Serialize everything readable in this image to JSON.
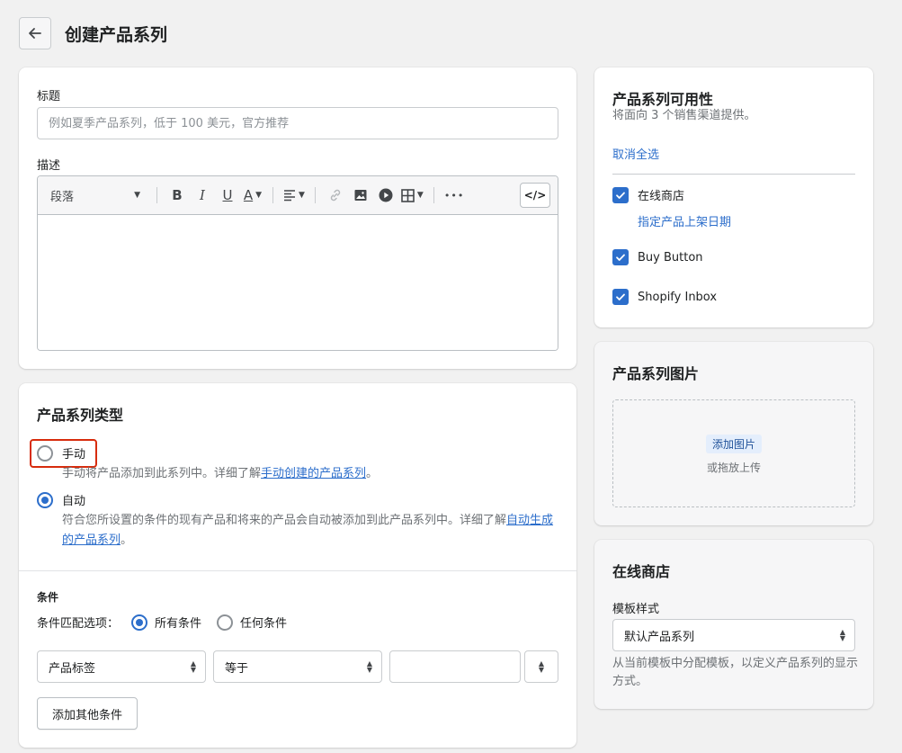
{
  "page": {
    "title": "创建产品系列"
  },
  "details": {
    "title_label": "标题",
    "title_placeholder": "例如夏季产品系列，低于 100 美元，官方推荐",
    "desc_label": "描述",
    "editor": {
      "format_select": "段落",
      "bold": "B",
      "italic": "I",
      "underline": "U",
      "text_color": "A",
      "more": "•••",
      "code": "</>"
    }
  },
  "collection_type": {
    "title": "产品系列类型",
    "manual": {
      "label": "手动",
      "help_prefix": "手动将产品添加到此系列中。详细了解",
      "help_link": "手动创建的产品系列",
      "help_suffix": "。"
    },
    "automatic": {
      "label": "自动",
      "help_prefix": "符合您所设置的条件的现有产品和将来的产品会自动被添加到此产品系列中。详细了解",
      "help_link": "自动生成的产品系列",
      "help_suffix": "。"
    },
    "selected": "automatic",
    "conditions": {
      "title": "条件",
      "match_label": "条件匹配选项：",
      "all_label": "所有条件",
      "any_label": "任何条件",
      "field": "产品标签",
      "operator": "等于",
      "value": "",
      "add_button": "添加其他条件"
    }
  },
  "availability": {
    "title": "产品系列可用性",
    "subtitle": "将面向 3 个销售渠道提供。",
    "deselect_all": "取消全选",
    "channels": [
      {
        "label": "在线商店",
        "checked": true,
        "sub_link": "指定产品上架日期"
      },
      {
        "label": "Buy Button",
        "checked": true
      },
      {
        "label": "Shopify Inbox",
        "checked": true
      }
    ]
  },
  "image": {
    "title": "产品系列图片",
    "add_button": "添加图片",
    "hint": "或拖放上传"
  },
  "online_store": {
    "title": "在线商店",
    "template_label": "模板样式",
    "template_value": "默认产品系列",
    "help": "从当前模板中分配模板，以定义产品系列的显示方式。"
  },
  "colors": {
    "accent": "#2c6ecb",
    "highlight": "#d72c0d",
    "page_bg": "#f1f1f1"
  }
}
